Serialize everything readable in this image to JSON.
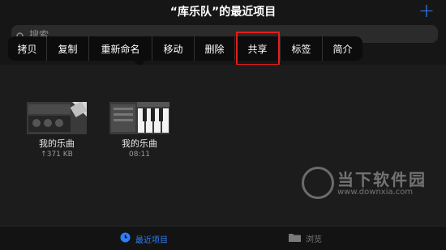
{
  "header": {
    "title": "“库乐队”的最近项目",
    "add_label": "+"
  },
  "search": {
    "placeholder": "搜索"
  },
  "context_menu": {
    "items": [
      {
        "label": "拷贝"
      },
      {
        "label": "复制"
      },
      {
        "label": "重新命名"
      },
      {
        "label": "移动"
      },
      {
        "label": "删除"
      },
      {
        "label": "共享"
      },
      {
        "label": "标签"
      },
      {
        "label": "简介"
      }
    ],
    "highlight_color": "#e51c1c"
  },
  "files": [
    {
      "name": "我的乐曲",
      "meta": "↑371 KB",
      "icon": "instrument-thumbnail"
    },
    {
      "name": "我的乐曲",
      "meta": "08:11",
      "icon": "keyboard-thumbnail"
    }
  ],
  "tabbar": {
    "recent_label": "最近项目",
    "browse_label": "浏览",
    "active_color": "#2f7ef5"
  },
  "watermark": {
    "text": "当下软件园",
    "url": "www.downxia.com"
  }
}
